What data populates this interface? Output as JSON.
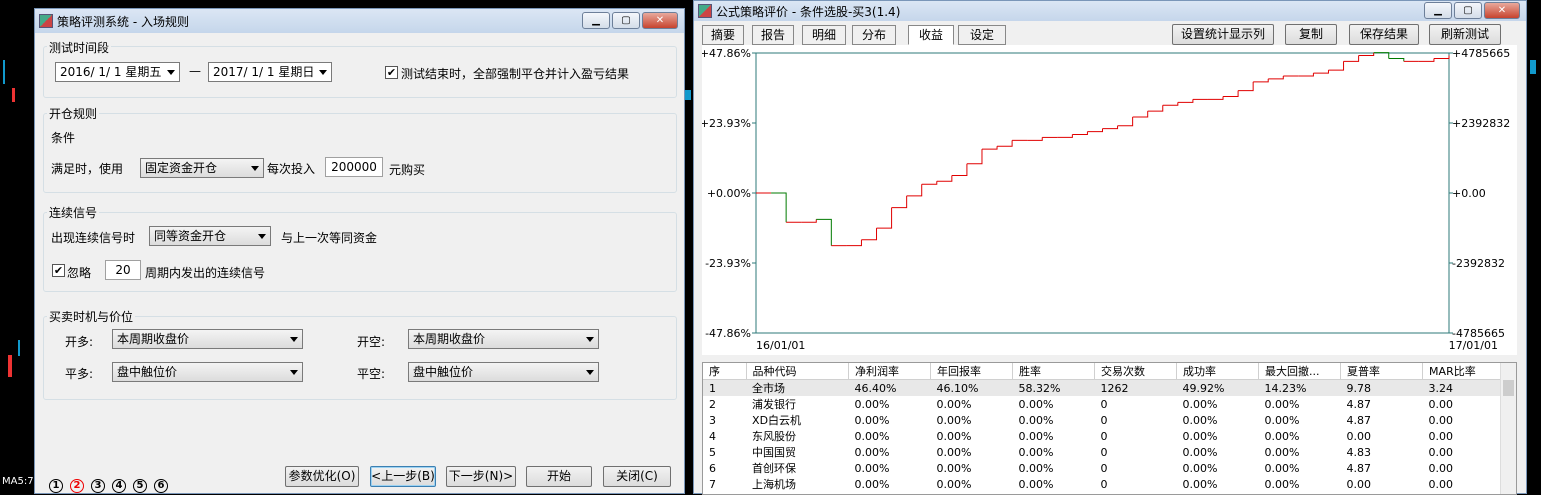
{
  "bg": {
    "ma_label": "MA5:7"
  },
  "left_win": {
    "title": "策略评测系统 - 入场规则",
    "test_period": {
      "legend": "测试时间段",
      "start_date": "2016/ 1/ 1 星期五",
      "dash": "—",
      "end_date": "2017/ 1/ 1 星期日",
      "force_close_checked": true,
      "force_close_label": "测试结束时，全部强制平仓并计入盈亏结果"
    },
    "open_rules": {
      "legend": "开仓规则",
      "condition_label": "条件",
      "when_label": "满足时，使用",
      "capital_mode": "固定资金开仓",
      "each_invest_label": "每次投入",
      "amount": "200000",
      "unit_label": "元购买"
    },
    "consecutive": {
      "legend": "连续信号",
      "appear_label": "出现连续信号时",
      "mode": "同等资金开仓",
      "same_label": "与上一次等同资金",
      "ignore_checked": true,
      "ignore_label": "忽略",
      "periods": "20",
      "period_label": "周期内发出的连续信号"
    },
    "timing": {
      "legend": "买卖时机与价位",
      "open_long_label": "开多:",
      "open_long": "本周期收盘价",
      "open_short_label": "开空:",
      "open_short": "本周期收盘价",
      "close_long_label": "平多:",
      "close_long": "盘中触位价",
      "close_short_label": "平空:",
      "close_short": "盘中触位价"
    },
    "steps": [
      "1",
      "2",
      "3",
      "4",
      "5",
      "6"
    ],
    "current_step": 2,
    "buttons": {
      "optimize": "参数优化(O)",
      "prev": "<上一步(B)",
      "next": "下一步(N)>",
      "start": "开始",
      "close": "关闭(C)"
    }
  },
  "right_win": {
    "title": "公式策略评价 - 条件选股-买3(1.4)",
    "tabs": [
      "摘要",
      "报告",
      "明细",
      "分布",
      "收益",
      "设定"
    ],
    "active_tab": "收益",
    "actions": {
      "set_columns": "设置统计显示列",
      "copy": "复制",
      "save": "保存结果",
      "refresh": "刷新测试"
    },
    "colors": {
      "up": "#e00000",
      "down": "#007a00",
      "axis": "#2c7a7a"
    }
  },
  "chart_data": {
    "type": "line",
    "y_left_ticks": [
      "+47.86%",
      "+23.93%",
      "+0.00%",
      "-23.93%",
      "-47.86%"
    ],
    "y_right_ticks": [
      "+4785665",
      "+2392832",
      "+0.00",
      "-2392832",
      "-4785665"
    ],
    "x_start": "16/01/01",
    "x_end": "17/01/01",
    "ylim": [
      -47.86,
      47.86
    ],
    "series": [
      {
        "values": [
          0,
          0,
          -10,
          -10,
          -9,
          -18,
          -18,
          -16,
          -12,
          -5,
          -1,
          3,
          4,
          6,
          10,
          15,
          16,
          18,
          18,
          19,
          19,
          20,
          21,
          22,
          23,
          26,
          28,
          30,
          31,
          32,
          32,
          33,
          35,
          38,
          39,
          40,
          40,
          41,
          42,
          45,
          47,
          48,
          46,
          45,
          45,
          46,
          47
        ]
      }
    ]
  },
  "table": {
    "columns": [
      "序",
      "品种代码",
      "净利润率",
      "年回报率",
      "胜率",
      "交易次数",
      "成功率",
      "最大回撤...",
      "夏普率",
      "MAR比率"
    ],
    "rows": [
      [
        "1",
        "全市场",
        "46.40%",
        "46.10%",
        "58.32%",
        "1262",
        "49.92%",
        "14.23%",
        "9.78",
        "3.24"
      ],
      [
        "2",
        "浦发银行",
        "0.00%",
        "0.00%",
        "0.00%",
        "0",
        "0.00%",
        "0.00%",
        "4.87",
        "0.00"
      ],
      [
        "3",
        "XD白云机",
        "0.00%",
        "0.00%",
        "0.00%",
        "0",
        "0.00%",
        "0.00%",
        "4.87",
        "0.00"
      ],
      [
        "4",
        "东风股份",
        "0.00%",
        "0.00%",
        "0.00%",
        "0",
        "0.00%",
        "0.00%",
        "0.00",
        "0.00"
      ],
      [
        "5",
        "中国国贸",
        "0.00%",
        "0.00%",
        "0.00%",
        "0",
        "0.00%",
        "0.00%",
        "4.83",
        "0.00"
      ],
      [
        "6",
        "首创环保",
        "0.00%",
        "0.00%",
        "0.00%",
        "0",
        "0.00%",
        "0.00%",
        "4.87",
        "0.00"
      ],
      [
        "7",
        "上海机场",
        "0.00%",
        "0.00%",
        "0.00%",
        "0",
        "0.00%",
        "0.00%",
        "0.00",
        "0.00"
      ]
    ]
  }
}
